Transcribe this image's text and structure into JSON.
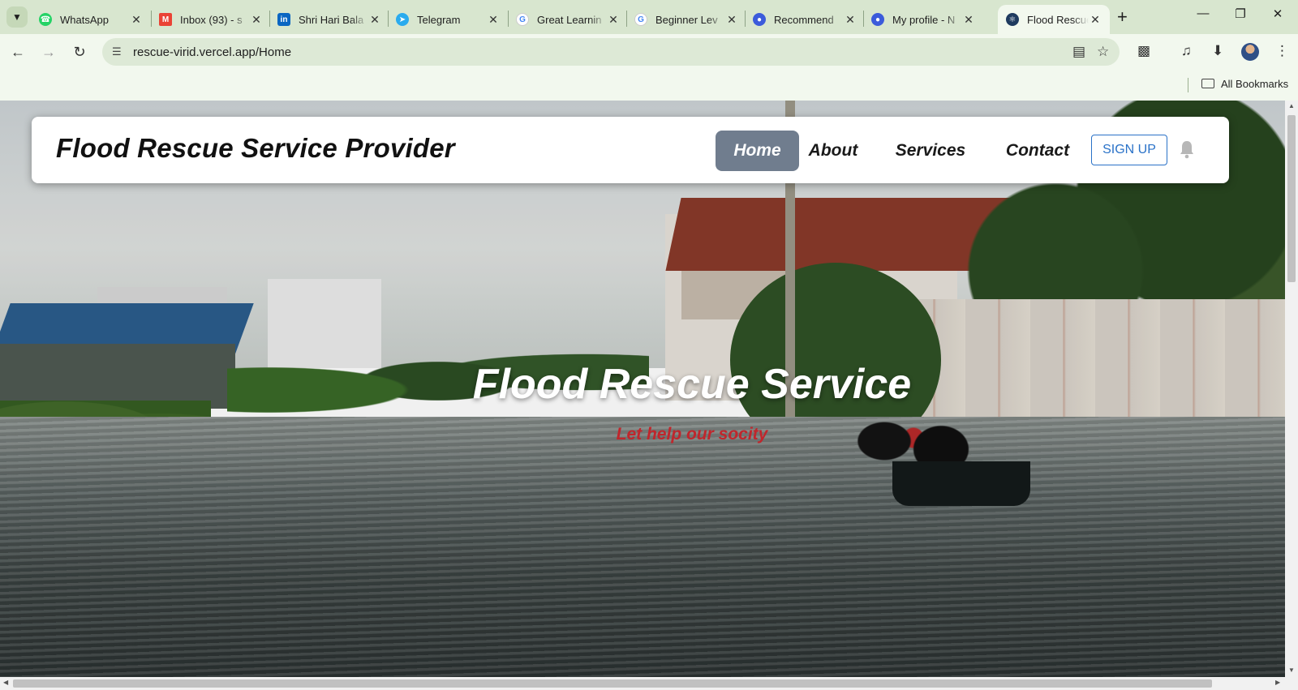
{
  "browser": {
    "tabs": [
      {
        "title": "WhatsApp",
        "icon": "whatsapp-icon",
        "color": "#25D366"
      },
      {
        "title": "Inbox (93) - s",
        "icon": "gmail-icon",
        "color": "#EA4335"
      },
      {
        "title": "Shri Hari Bala",
        "icon": "linkedin-icon",
        "color": "#0A66C2"
      },
      {
        "title": "Telegram",
        "icon": "telegram-icon",
        "color": "#2AABEE"
      },
      {
        "title": "Great Learnin",
        "icon": "google-icon",
        "color": "#4285F4"
      },
      {
        "title": "Beginner Lev",
        "icon": "google-icon",
        "color": "#4285F4"
      },
      {
        "title": "Recommend",
        "icon": "site-icon",
        "color": "#3b5bdb"
      },
      {
        "title": "My profile - N",
        "icon": "site-icon",
        "color": "#3b5bdb"
      },
      {
        "title": "Flood Rescue",
        "icon": "react-icon",
        "color": "#1e3a5f",
        "active": true
      }
    ],
    "url": "rescue-virid.vercel.app/Home",
    "bookmarks": {
      "all_label": "All Bookmarks"
    }
  },
  "site": {
    "brand": "Flood Rescue Service Provider",
    "nav": [
      {
        "label": "Home",
        "active": true
      },
      {
        "label": "About"
      },
      {
        "label": "Services"
      },
      {
        "label": "Contact"
      }
    ],
    "signup_label": "SIGN UP",
    "hero": {
      "title": "Flood Rescue Service",
      "subtitle": "Let help our socity"
    },
    "accent_color": "#707d8e",
    "subtitle_color": "#c0262c",
    "signup_color": "#2a72c8"
  }
}
